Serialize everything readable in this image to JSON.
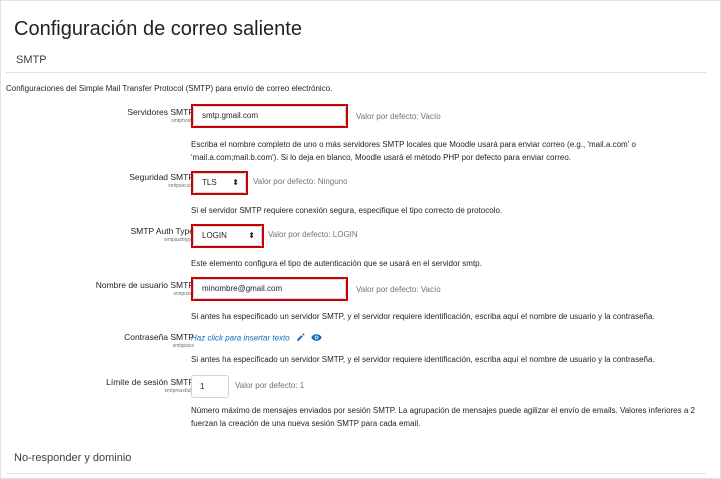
{
  "page": {
    "title": "Configuración de correo saliente",
    "section_title": "SMTP",
    "intro": "Configuraciones del Simple Mail Transfer Protocol (SMTP) para envío de correo electrónico.",
    "bottom_section": "No-responder y dominio"
  },
  "fields": {
    "smtphosts": {
      "label": "Servidores SMTP",
      "key": "smtphosts",
      "value": "smtp.gmail.com",
      "default": "Valor por defecto: Vacío",
      "desc": "Escriba el nombre completo de uno o más servidores SMTP locales que Moodle usará para enviar correo (e.g., 'mail.a.com' o 'mail.a.com;mail.b.com'). Si lo deja en blanco, Moodle usará el método PHP por defecto para enviar correo."
    },
    "smtpsecure": {
      "label": "Seguridad SMTP",
      "key": "smtpsecure",
      "value": "TLS",
      "default": "Valor por defecto: Ninguno",
      "desc": "Si el servidor SMTP requiere conexión segura, especifique el tipo correcto de protocolo."
    },
    "smtpauthtype": {
      "label": "SMTP Auth Type",
      "key": "smtpauthtype",
      "value": "LOGIN",
      "default": "Valor por defecto: LOGIN",
      "desc": "Este elemento configura el tipo de autenticación que se usará en el servidor smtp."
    },
    "smtpuser": {
      "label": "Nombre de usuario SMTP",
      "key": "smtpuser",
      "value": "minombre@gmail.com",
      "default": "Valor por defecto: Vacío",
      "desc": "Si antes ha especificado un servidor SMTP, y el servidor requiere identificación, escriba aquí el nombre de usuario y la contraseña."
    },
    "smtppass": {
      "label": "Contraseña SMTP",
      "key": "smtppass",
      "link": "Haz click para insertar texto",
      "desc": "Si antes ha especificado un servidor SMTP, y el servidor requiere identificación, escriba aquí el nombre de usuario y la contraseña."
    },
    "smtpmaxbulk": {
      "label": "Límite de sesión SMTP",
      "key": "smtpmaxbulk",
      "value": "1",
      "default": "Valor por defecto: 1",
      "desc": "Número máximo de mensajes enviados por sesión SMTP. La agrupación de mensajes puede agilizar el envío de emails. Valores inferiores a 2 fuerzan la creación de una nueva sesión SMTP para cada email."
    }
  },
  "icons": {
    "edit": "pencil-icon",
    "reveal": "eye-icon"
  },
  "colors": {
    "link": "#0f6cbf",
    "highlight": "#cc0000",
    "muted": "#6a737b"
  }
}
